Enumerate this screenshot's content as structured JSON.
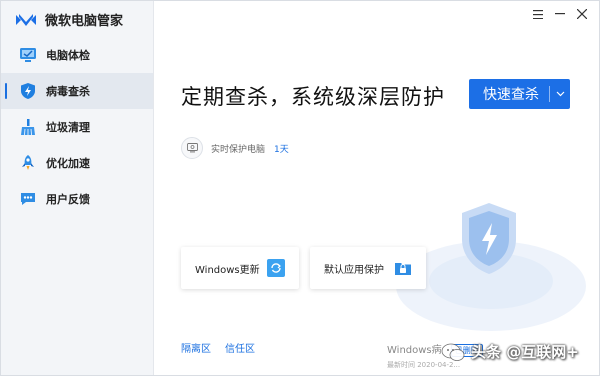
{
  "app": {
    "title": "微软电脑管家"
  },
  "sidebar": {
    "items": [
      {
        "label": "电脑体检",
        "icon": "monitor-check-icon",
        "active": false
      },
      {
        "label": "病毒查杀",
        "icon": "shield-bolt-icon",
        "active": true
      },
      {
        "label": "垃圾清理",
        "icon": "broom-icon",
        "active": false
      },
      {
        "label": "优化加速",
        "icon": "rocket-icon",
        "active": false
      },
      {
        "label": "用户反馈",
        "icon": "feedback-icon",
        "active": false
      }
    ]
  },
  "window_controls": {
    "menu": "≡",
    "minimize": "—",
    "close": "✕"
  },
  "main": {
    "headline": "定期查杀，系统级深层防护",
    "scan_button": "快速查杀",
    "status": {
      "text": "实时保护电脑",
      "days": "1天"
    },
    "cards": [
      {
        "label": "Windows更新",
        "icon": "windows-update-icon"
      },
      {
        "label": "默认应用保护",
        "icon": "lock-folder-icon"
      }
    ],
    "links": [
      "隔离区",
      "信任区"
    ],
    "bottom_info": {
      "title": "Windows病",
      "pill": "已删除",
      "sub": "最新时间 2020-04-2..."
    }
  },
  "watermark": {
    "text": "头条 @互联网+"
  },
  "colors": {
    "accent": "#1c6fe6",
    "sidebar_bg": "#f3f5f8",
    "active_bg": "#e3e8ef"
  }
}
